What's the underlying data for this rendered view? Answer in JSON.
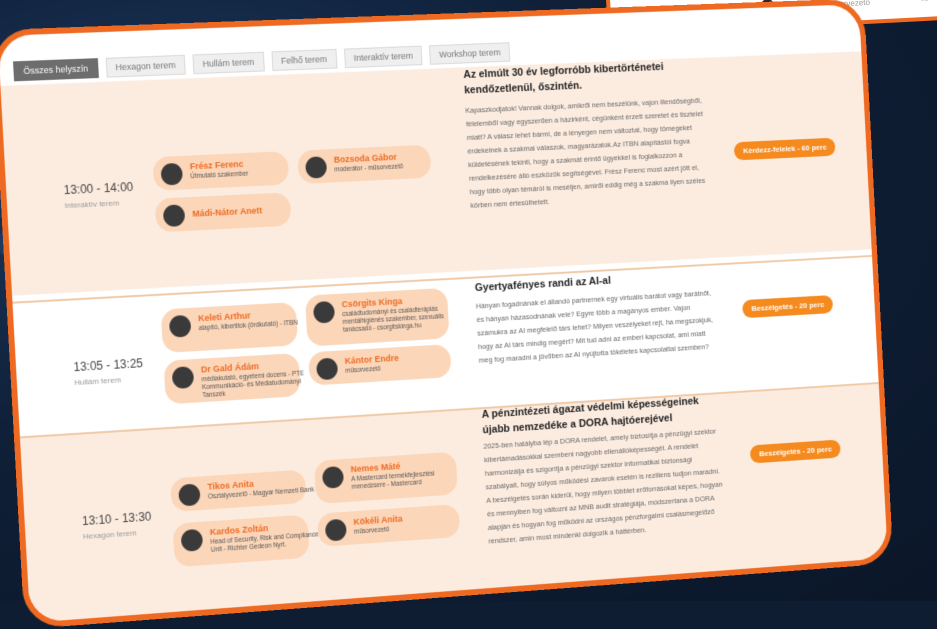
{
  "peek": {
    "role": "moderátor - műsorvezető",
    "arrow": "→"
  },
  "tabs": [
    "Összes helyszín",
    "Hexagon terem",
    "Hullám terem",
    "Felhő terem",
    "Interaktív terem",
    "Workshop terem"
  ],
  "sessions": [
    {
      "time": "13:00 - 14:00",
      "room": "Interaktív terem",
      "speakers": [
        {
          "name": "Frész Ferenc",
          "role": "Útmutató szakember"
        },
        {
          "name": "Bozsoda Gábor",
          "role": "moderátor - műsorvezető"
        },
        {
          "name": "Mádi-Nátor Anett",
          "role": ""
        }
      ],
      "title": "Az elmúlt 30 év legforróbb kibertörténetei kendőzetlenül, őszintén.",
      "description": "Kapaszkodjatok! Vannak dolgok, amikről nem beszélünk, vajon illendőségből, félelemből vagy egyszerűen a házirként, cégünként érzett szeretet és tisztelet miatt? A válasz lehet bármi, de a lényegen nem változtat, hogy tömegeket érdekelnek a szakmai válaszok, magyarázatok.Az ITBN alapítástól fogva küldetésének tekinti, hogy a szakmát érintő ügyekkel is foglalkozzon a rendelkezésére álló eszközök segítségével. Frész Ferenc most azért jött el, hogy több olyan témáról is meséljen, amiről eddig még a szakma ilyen széles körben nem értesülhetett.",
      "badge": "Kérdezz-felelek - 60 perc"
    },
    {
      "time": "13:05 - 13:25",
      "room": "Hullám terem",
      "speakers": [
        {
          "name": "Keleti Arthur",
          "role": "alapító, kibertitok (ördkutató) - ITBN"
        },
        {
          "name": "Csörgits Kinga",
          "role": "családtudományi és családterápiás mentálhigiénés szakember, szexuális tanácsadó - csorgitskinga.hu"
        },
        {
          "name": "Dr Gald Ádám",
          "role": "médiakutató, egyetemi docens - PTE Kommunikáció- és Médiatudományi Tanszék"
        },
        {
          "name": "Kántor Endre",
          "role": "műsorvezető"
        }
      ],
      "title": "Gyertyafényes randi az AI-al",
      "description": "Hányan fogadnának el állandó partnernek egy virtuális barátot vagy barátnőt, és hányan házasodnának vele? Egyre több a magányos ember. Vajon számukra az AI megfelelő társ lehet? Milyen veszélyeket rejt, ha megszokjuk, hogy az AI társ mindig megért? Mit tud adni az emberi kapcsolat, ami miatt meg fog maradni a jövőben az AI nyújtotta tökéletes kapcsolattal szemben?",
      "badge": "Beszélgetés - 20 perc"
    },
    {
      "time": "13:10 - 13:30",
      "room": "Hexagon terem",
      "speakers": [
        {
          "name": "Tikos Anita",
          "role": "Osztályvezető - Magyar Nemzeti Bank"
        },
        {
          "name": "Nemes Máté",
          "role": "A Mastercard termékfejlesztési menedzsere - Mastercard"
        },
        {
          "name": "Kardos Zoltán",
          "role": "Head of Security, Risk and Compliance Unit - Richter Gedeon Nyrt."
        },
        {
          "name": "Kökéli Anita",
          "role": "műsorvezető"
        }
      ],
      "title": "A pénzintézeti ágazat védelmi képességeinek újabb nemzedéke a DORA hajtóerejével",
      "description": "2025-ben hatályba lép a DORA rendelet, amely biztosítja a pénzügyi szektor kibertámadásokkal szembeni nagyobb ellenállóképességét. A rendelet harmonizálja és szigorítja a pénzügyi szektor informatikai biztonsági szabályait, hogy súlyos működési zavarok esetén is reziliens tudjon maradni. A beszélgetés során kiderül, hogy milyen többlet erőforrásokat képes, hogyan és mennyiben fog változni az MNB audit stratégiája, módszertana a DORA alapján és hogyan fog működni az országos pénzforgalmi csalásmegelőző rendszer, amin most mindenki dolgozik a háttérben.",
      "badge": "Beszélgetés - 20 perc"
    }
  ]
}
